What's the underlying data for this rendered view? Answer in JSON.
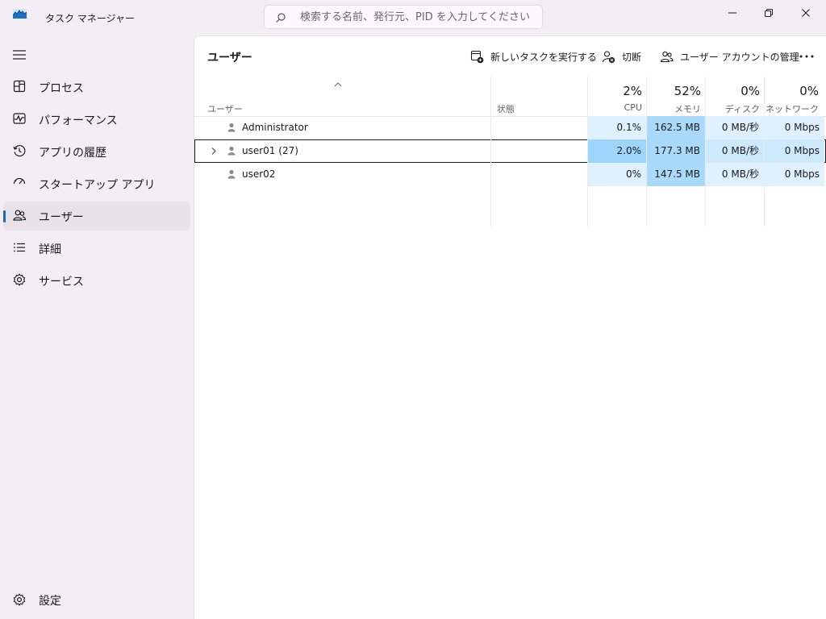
{
  "window": {
    "title": "タスク マネージャー",
    "controls": {
      "minimize": "minimize-icon",
      "maximize": "restore-icon",
      "close": "close-icon"
    }
  },
  "search": {
    "placeholder": "検索する名前、発行元、PID を入力してください",
    "value": ""
  },
  "sidebar": {
    "items": [
      {
        "label": "プロセス",
        "icon": "processes-icon"
      },
      {
        "label": "パフォーマンス",
        "icon": "performance-icon"
      },
      {
        "label": "アプリの履歴",
        "icon": "app-history-icon"
      },
      {
        "label": "スタートアップ アプリ",
        "icon": "startup-apps-icon"
      },
      {
        "label": "ユーザー",
        "icon": "users-icon",
        "active": true
      },
      {
        "label": "詳細",
        "icon": "details-icon"
      },
      {
        "label": "サービス",
        "icon": "services-icon"
      }
    ],
    "settings": {
      "label": "設定",
      "icon": "settings-icon"
    }
  },
  "main": {
    "title": "ユーザー",
    "toolbar": {
      "new_task": "新しいタスクを実行する",
      "disconnect": "切断",
      "manage_accounts": "ユーザー アカウントの管理",
      "more": "..."
    },
    "table": {
      "columns": {
        "user": "ユーザー",
        "status": "状態",
        "cpu": {
          "pct": "2%",
          "label": "CPU"
        },
        "memory": {
          "pct": "52%",
          "label": "メモリ"
        },
        "disk": {
          "pct": "0%",
          "label": "ディスク"
        },
        "network": {
          "pct": "0%",
          "label": "ネットワーク"
        }
      },
      "rows": [
        {
          "name": "Administrator",
          "status": "",
          "cpu": "0.1%",
          "memory": "162.5 MB",
          "disk": "0 MB/秒",
          "network": "0 Mbps"
        },
        {
          "name": "user01 (27)",
          "status": "",
          "cpu": "2.0%",
          "memory": "177.3 MB",
          "disk": "0 MB/秒",
          "network": "0 Mbps",
          "selected": true,
          "expandable": true
        },
        {
          "name": "user02",
          "status": "",
          "cpu": "0%",
          "memory": "147.5 MB",
          "disk": "0 MB/秒",
          "network": "0 Mbps"
        }
      ]
    }
  },
  "colors": {
    "accent": "#1d65b5",
    "heat_light": "#dff1ff",
    "heat_medium": "#cdeafd",
    "heat_strong": "#9fd5fb",
    "heat_memory": "#a9dafc"
  }
}
